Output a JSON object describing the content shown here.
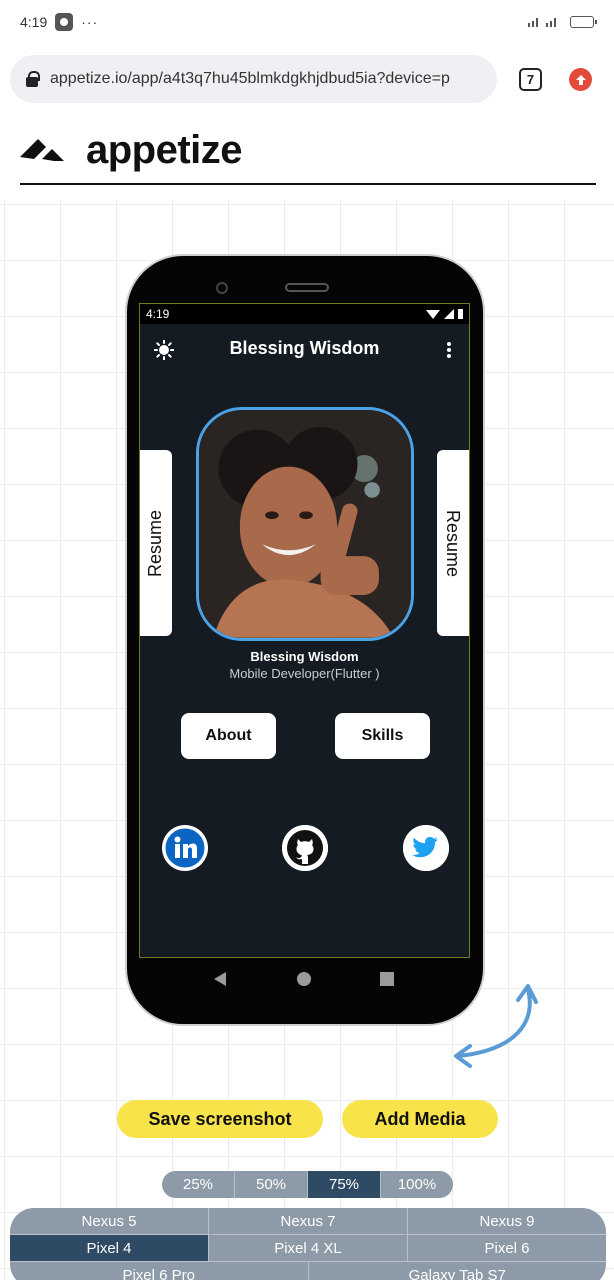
{
  "system_bar": {
    "time": "4:19",
    "more": "···",
    "signal": "³²ᴳᴵ .ᴵᴵ"
  },
  "browser": {
    "url": "appetize.io/app/a4t3q7hu45blmkdgkhjdbud5ia?device=p",
    "tab_count": "7"
  },
  "brand": {
    "name": "appetize"
  },
  "device_screen": {
    "status_time": "4:19",
    "app_title": "Blessing Wisdom",
    "resume_left": "Resume",
    "resume_right": "Resume",
    "profile_name": "Blessing Wisdom",
    "profile_role": "Mobile Developer(Flutter )",
    "about_label": "About",
    "skills_label": "Skills",
    "social_icons": [
      "linkedin-icon",
      "github-icon",
      "twitter-icon"
    ]
  },
  "actions": {
    "save_screenshot": "Save screenshot",
    "add_media": "Add Media"
  },
  "zoom": {
    "options": [
      "25%",
      "50%",
      "75%",
      "100%"
    ],
    "selected": "75%"
  },
  "devices": {
    "rows": [
      [
        "Nexus 5",
        "Nexus 7",
        "Nexus 9"
      ],
      [
        "Pixel 4",
        "Pixel 4 XL",
        "Pixel 6"
      ],
      [
        "Pixel 6 Pro",
        "Galaxy Tab S7"
      ]
    ],
    "selected": "Pixel 4"
  },
  "colors": {
    "accent_yellow": "#f8e34a",
    "selected_blue": "#2f4a64",
    "segment_gray": "#8d9aa7",
    "photo_ring": "#4aa3e8",
    "app_bg": "#141b22"
  }
}
